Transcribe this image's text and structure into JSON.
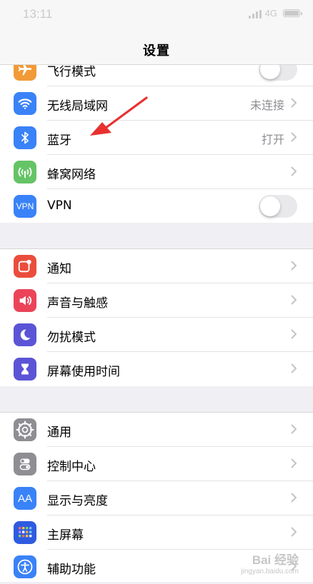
{
  "status": {
    "time": "13:11",
    "network": "4G"
  },
  "nav": {
    "title": "设置"
  },
  "group1": [
    {
      "label": "飞行模式",
      "control": "toggle",
      "toggle_on": false,
      "icon": "airplane-icon",
      "color": "#f19a37"
    },
    {
      "label": "无线局域网",
      "value": "未连接",
      "control": "chevron",
      "icon": "wifi-icon",
      "color": "#3a82f7"
    },
    {
      "label": "蓝牙",
      "value": "打开",
      "control": "chevron",
      "icon": "bluetooth-icon",
      "color": "#3a82f7"
    },
    {
      "label": "蜂窝网络",
      "control": "chevron",
      "icon": "cellular-icon",
      "color": "#65c466"
    },
    {
      "label": "VPN",
      "control": "toggle",
      "toggle_on": false,
      "icon": "vpn-icon",
      "icon_text": "VPN",
      "color": "#3a82f7"
    }
  ],
  "group2": [
    {
      "label": "通知",
      "icon": "notifications-icon",
      "color": "#eb4d3d"
    },
    {
      "label": "声音与触感",
      "icon": "speaker-icon",
      "color": "#eb4459"
    },
    {
      "label": "勿扰模式",
      "icon": "moon-icon",
      "color": "#5b54d6"
    },
    {
      "label": "屏幕使用时间",
      "icon": "hourglass-icon",
      "color": "#5b54d6"
    }
  ],
  "group3": [
    {
      "label": "通用",
      "icon": "gear-icon",
      "color": "#8e8e93"
    },
    {
      "label": "控制中心",
      "icon": "toggles-icon",
      "color": "#8e8e93"
    },
    {
      "label": "显示与亮度",
      "icon": "display-icon",
      "icon_text": "AA",
      "color": "#3a82f7"
    },
    {
      "label": "主屏幕",
      "icon": "home-screen-icon",
      "color": "#2f5be0"
    },
    {
      "label": "辅助功能",
      "icon": "accessibility-icon",
      "color": "#3a82f7"
    }
  ],
  "annotation": {
    "color": "#e8312f"
  },
  "watermark": {
    "logo": "Bai 经验",
    "url": "jingyan.baidu.com"
  }
}
